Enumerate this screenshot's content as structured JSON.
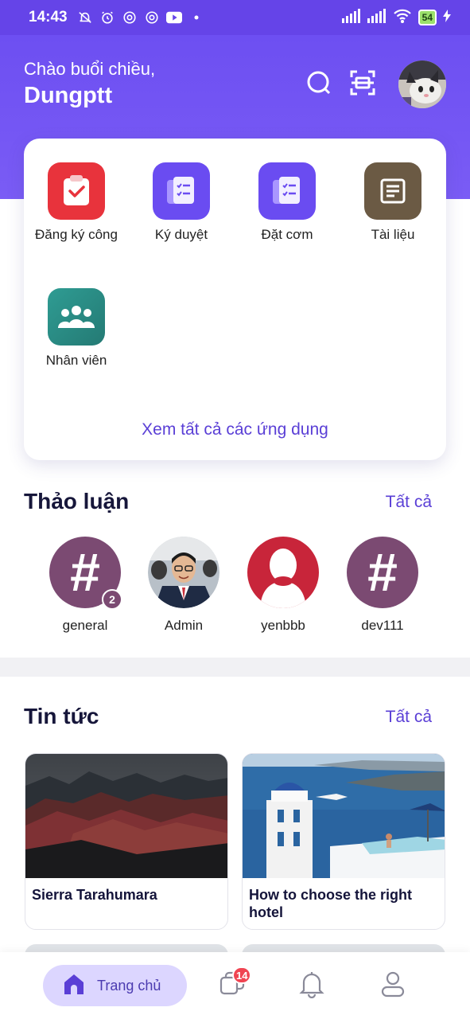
{
  "status_bar": {
    "time": "14:43",
    "battery": "54",
    "icons": [
      "mute-icon",
      "alarm-icon",
      "privacy-icon",
      "privacy-icon",
      "youtube-icon",
      "dot-icon",
      "signal-icon",
      "signal-icon",
      "wifi-icon",
      "battery-icon",
      "charging-icon"
    ]
  },
  "header": {
    "greeting": "Chào buổi chiều,",
    "username": "Dungptt",
    "icons": [
      "search-icon",
      "scan-icon"
    ],
    "accent": "#6a4cf1"
  },
  "apps": {
    "items": [
      {
        "label": "Đăng ký công",
        "icon": "clipboard-check-icon",
        "color": "#e8333c"
      },
      {
        "label": "Ký duyệt",
        "icon": "document-list-icon",
        "color": "#6a4cf1"
      },
      {
        "label": "Đặt cơm",
        "icon": "document-list-icon",
        "color": "#6a4cf1"
      },
      {
        "label": "Tài liệu",
        "icon": "document-icon",
        "color": "#6b5a44"
      },
      {
        "label": "Nhân viên",
        "icon": "people-icon",
        "color": "#2a8f88"
      }
    ],
    "view_all": "Xem tất cả các ứng dụng"
  },
  "discussions": {
    "title": "Thảo luận",
    "see_all": "Tất cả",
    "items": [
      {
        "name": "general",
        "type": "channel",
        "badge": "2"
      },
      {
        "name": "Admin",
        "type": "user"
      },
      {
        "name": "yenbbb",
        "type": "user"
      },
      {
        "name": "dev111",
        "type": "channel"
      }
    ]
  },
  "news": {
    "title": "Tin tức",
    "see_all": "Tất cả",
    "items": [
      {
        "title": "Sierra Tarahumara"
      },
      {
        "title": "How to choose the right hotel"
      }
    ]
  },
  "bottom_nav": {
    "home_label": "Trang chủ",
    "chat_badge": "14",
    "icons": [
      "home-icon",
      "chat-icon",
      "bell-icon",
      "profile-icon"
    ]
  }
}
